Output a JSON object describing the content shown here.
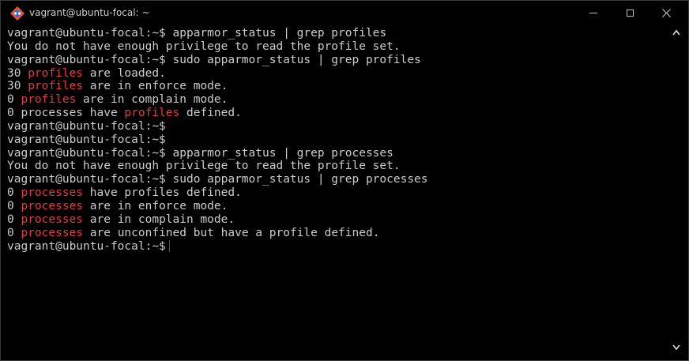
{
  "window": {
    "title": "vagrant@ubuntu-focal: ~",
    "controls": {
      "minimize": "minimize",
      "maximize": "maximize",
      "close": "✕"
    }
  },
  "terminal": {
    "lines": [
      [
        {
          "t": "vagrant@ubuntu-focal:~$ apparmor_status | grep profiles"
        }
      ],
      [
        {
          "t": "You do not have enough privilege to read the profile set."
        }
      ],
      [
        {
          "t": "vagrant@ubuntu-focal:~$ sudo apparmor_status | grep profiles"
        }
      ],
      [
        {
          "t": "30 "
        },
        {
          "t": "profiles",
          "hl": true
        },
        {
          "t": " are loaded."
        }
      ],
      [
        {
          "t": "30 "
        },
        {
          "t": "profiles",
          "hl": true
        },
        {
          "t": " are in enforce mode."
        }
      ],
      [
        {
          "t": "0 "
        },
        {
          "t": "profiles",
          "hl": true
        },
        {
          "t": " are in complain mode."
        }
      ],
      [
        {
          "t": "0 processes have "
        },
        {
          "t": "profiles",
          "hl": true
        },
        {
          "t": " defined."
        }
      ],
      [
        {
          "t": "vagrant@ubuntu-focal:~$"
        }
      ],
      [
        {
          "t": "vagrant@ubuntu-focal:~$"
        }
      ],
      [
        {
          "t": "vagrant@ubuntu-focal:~$ apparmor_status | grep processes"
        }
      ],
      [
        {
          "t": "You do not have enough privilege to read the profile set."
        }
      ],
      [
        {
          "t": "vagrant@ubuntu-focal:~$ sudo apparmor_status | grep processes"
        }
      ],
      [
        {
          "t": "0 "
        },
        {
          "t": "processes",
          "hl": true
        },
        {
          "t": " have profiles defined."
        }
      ],
      [
        {
          "t": "0 "
        },
        {
          "t": "processes",
          "hl": true
        },
        {
          "t": " are in enforce mode."
        }
      ],
      [
        {
          "t": "0 "
        },
        {
          "t": "processes",
          "hl": true
        },
        {
          "t": " are in complain mode."
        }
      ],
      [
        {
          "t": "0 "
        },
        {
          "t": "processes",
          "hl": true
        },
        {
          "t": " are unconfined but have a profile defined."
        }
      ]
    ],
    "prompt": "vagrant@ubuntu-focal:~$ "
  },
  "colors": {
    "background": "#000000",
    "foreground": "#cccccc",
    "highlight": "#e23c3c"
  },
  "icons": [
    "git-bash-icon",
    "minimize-icon",
    "maximize-icon",
    "close-icon",
    "scroll-up-icon",
    "scroll-down-icon"
  ]
}
